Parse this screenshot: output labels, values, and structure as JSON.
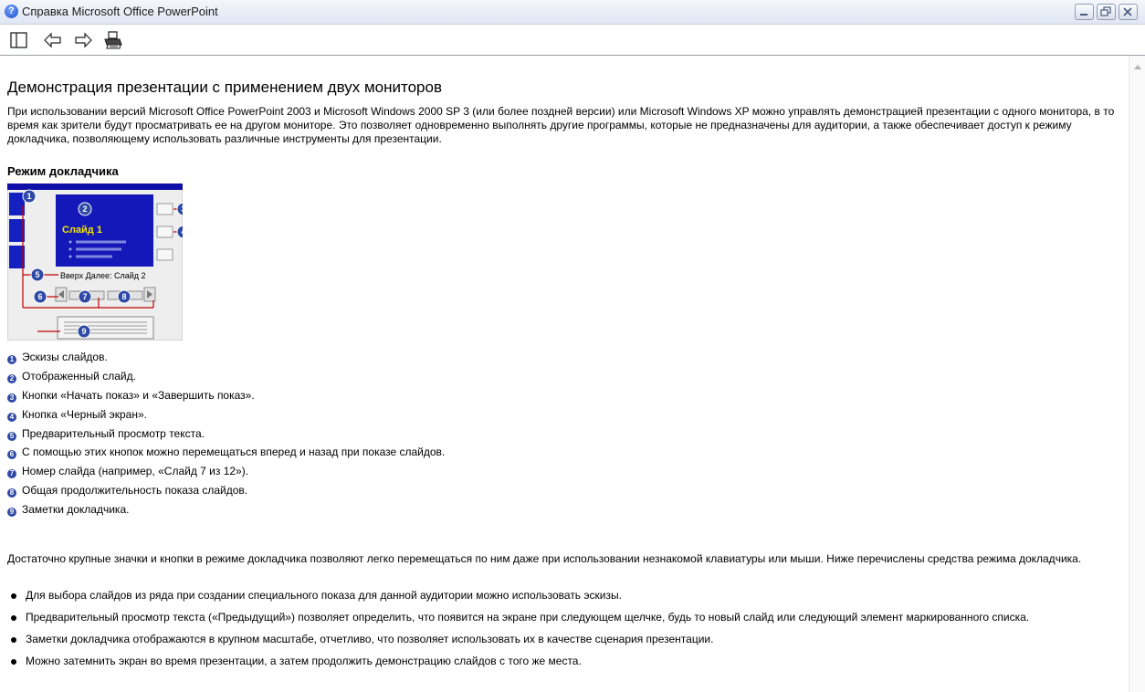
{
  "window": {
    "title": "Справка Microsoft Office PowerPoint",
    "icon": "help-icon",
    "controls": [
      "minimize-icon",
      "restore-icon",
      "close-icon"
    ]
  },
  "toolbar": {
    "buttons": [
      "hide-panel-icon",
      "back-arrow-icon",
      "forward-arrow-icon",
      "print-icon"
    ]
  },
  "article": {
    "title": "Демонстрация презентации с применением двух мониторов",
    "intro": "При использовании версий Microsoft Office PowerPoint 2003 и Microsoft Windows 2000 SP 3 (или более поздней версии) или Microsoft Windows XP можно управлять демонстрацией презентации с одного монитора, в то время как зрители будут просматривать ее на другом мониторе. Это позволяет одновременно выполнять другие программы, которые не предназначены для аудитории, а также обеспечивает доступ к режиму докладчика, позволяющему использовать различные инструменты для презентации.",
    "section_title": "Режим докладчика",
    "diagram": {
      "slide_title": "Слайд 1",
      "next_text": "Вверх Далее: Слайд 2",
      "callouts": [
        "1",
        "2",
        "3",
        "4",
        "5",
        "6",
        "7",
        "8",
        "9"
      ]
    },
    "legend": [
      {
        "num": "1",
        "text": "Эскизы слайдов."
      },
      {
        "num": "2",
        "text": "Отображенный слайд."
      },
      {
        "num": "3",
        "text": "Кнопки «Начать показ» и «Завершить показ»."
      },
      {
        "num": "4",
        "text": "Кнопка «Черный экран»."
      },
      {
        "num": "5",
        "text": "Предварительный просмотр текста."
      },
      {
        "num": "6",
        "text": "С помощью этих кнопок можно перемещаться вперед и назад при показе слайдов."
      },
      {
        "num": "7",
        "text": "Номер слайда (например, «Слайд 7 из 12»)."
      },
      {
        "num": "8",
        "text": "Общая продолжительность показа слайдов."
      },
      {
        "num": "9",
        "text": "Заметки докладчика."
      }
    ],
    "paragraph": "Достаточно крупные значки и кнопки в режиме докладчика позволяют легко перемещаться по ним даже при использовании незнакомой клавиатуры или мыши. Ниже перечислены средства режима докладчика.",
    "bullets": [
      "Для выбора слайдов из ряда при создании специального показа для данной аудитории можно использовать эскизы.",
      "Предварительный просмотр текста («Предыдущий») позволяет определить, что появится на экране при следующем щелчке, будь то новый слайд или следующий элемент маркированного списка.",
      "Заметки докладчика отображаются в крупном масштабе, отчетливо, что позволяет использовать их в качестве сценария презентации.",
      "Можно затемнить экран во время презентации, а затем продолжить демонстрацию слайдов с того же места."
    ]
  }
}
